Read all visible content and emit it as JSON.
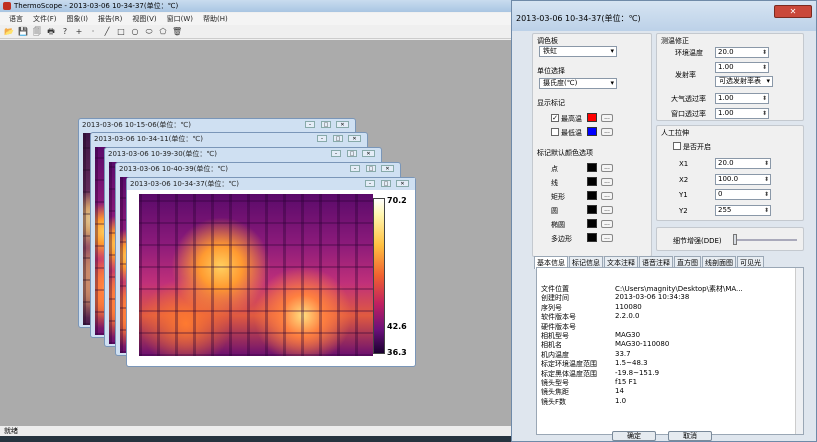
{
  "app": {
    "title": "ThermoScope - 2013-03-06 10-34-37(单位：℃)"
  },
  "menu": [
    "语言",
    "文件(F)",
    "图象(I)",
    "报告(R)",
    "视图(V)",
    "窗口(W)",
    "帮助(H)"
  ],
  "toolbar_icons": [
    "open-icon",
    "save-icon",
    "save-all-icon",
    "print-icon",
    "help-icon",
    "cursor-icon",
    "point-icon",
    "line-icon",
    "rect-icon",
    "circle-icon",
    "ellipse-icon",
    "polygon-icon",
    "delete-icon"
  ],
  "toolbar_glyphs": [
    "📂",
    "💾",
    "🗐",
    "🖶",
    "?",
    "+",
    "·",
    "╱",
    "□",
    "○",
    "⬭",
    "⬠",
    "🗑"
  ],
  "status": "就绪",
  "windows": [
    {
      "title": "2013-03-06 10-15-06(单位：℃)"
    },
    {
      "title": "2013-03-06 10-34-11(单位：℃)"
    },
    {
      "title": "2013-03-06 10-39-30(单位：℃)"
    },
    {
      "title": "2013-03-06 10-40-39(单位：℃)"
    },
    {
      "title": "2013-03-06 10-34-37(单位：℃)"
    }
  ],
  "scale": {
    "max": "70.2",
    "mid": "42.6",
    "min": "36.3"
  },
  "dialog": {
    "title": "2013-03-06 10-34-37(单位：℃)",
    "close_label": "✕",
    "palette": {
      "label": "调色板",
      "value": "铁虹"
    },
    "unit": {
      "label": "单位选择",
      "value": "摄氏度(℃)"
    },
    "markers": {
      "label": "显示标记",
      "max_label": "最高温",
      "min_label": "最低温",
      "max_checked": true,
      "min_checked": false,
      "max_color": "#ff0000",
      "min_color": "#0000ff",
      "dots": "..."
    },
    "mark_colors": {
      "label": "标记默认颜色选项",
      "items": [
        "点",
        "线",
        "矩形",
        "圆",
        "椭圆",
        "多边形"
      ]
    },
    "correction": {
      "label": "测温修正",
      "env_temp_label": "环境温度",
      "env_temp": "20.0",
      "emissivity_label": "发射率",
      "emissivity": "1.00",
      "emis_table": "可选发射率表",
      "atm_label": "大气透过率",
      "atm": "1.00",
      "win_label": "窗口透过率",
      "win": "1.00"
    },
    "stretch": {
      "label": "人工拉伸",
      "enable_label": "是否开启",
      "x1_label": "X1",
      "x1": "20.0",
      "x2_label": "X2",
      "x2": "100.0",
      "y1_label": "Y1",
      "y1": "0",
      "y2_label": "Y2",
      "y2": "255"
    },
    "dde_label": "细节增强(DDE)",
    "tabs": [
      "基本信息",
      "标记信息",
      "文本注释",
      "语音注释",
      "直方图",
      "线剖面图",
      "可见光"
    ],
    "info": [
      [
        "文件位置",
        "C:\\Users\\magnity\\Desktop\\素材\\MA..."
      ],
      [
        "创建时间",
        "2013-03-06 10:34:38"
      ],
      [
        "序列号",
        "110080"
      ],
      [
        "软件版本号",
        "2.2.0.0"
      ],
      [
        "硬件版本号",
        ""
      ],
      [
        "相机型号",
        "MAG30"
      ],
      [
        "相机名",
        "MAG30-110080"
      ],
      [
        "机内温度",
        "33.7"
      ],
      [
        "标定环境温度范围",
        "1.5~48.3"
      ],
      [
        "标定黑体温度范围",
        "-19.8~151.9"
      ],
      [
        "镜头型号",
        "f15 F1"
      ],
      [
        "镜头焦距",
        "14"
      ],
      [
        "镜头F数",
        "1.0"
      ]
    ],
    "ok_label": "确定",
    "cancel_label": "取消"
  }
}
